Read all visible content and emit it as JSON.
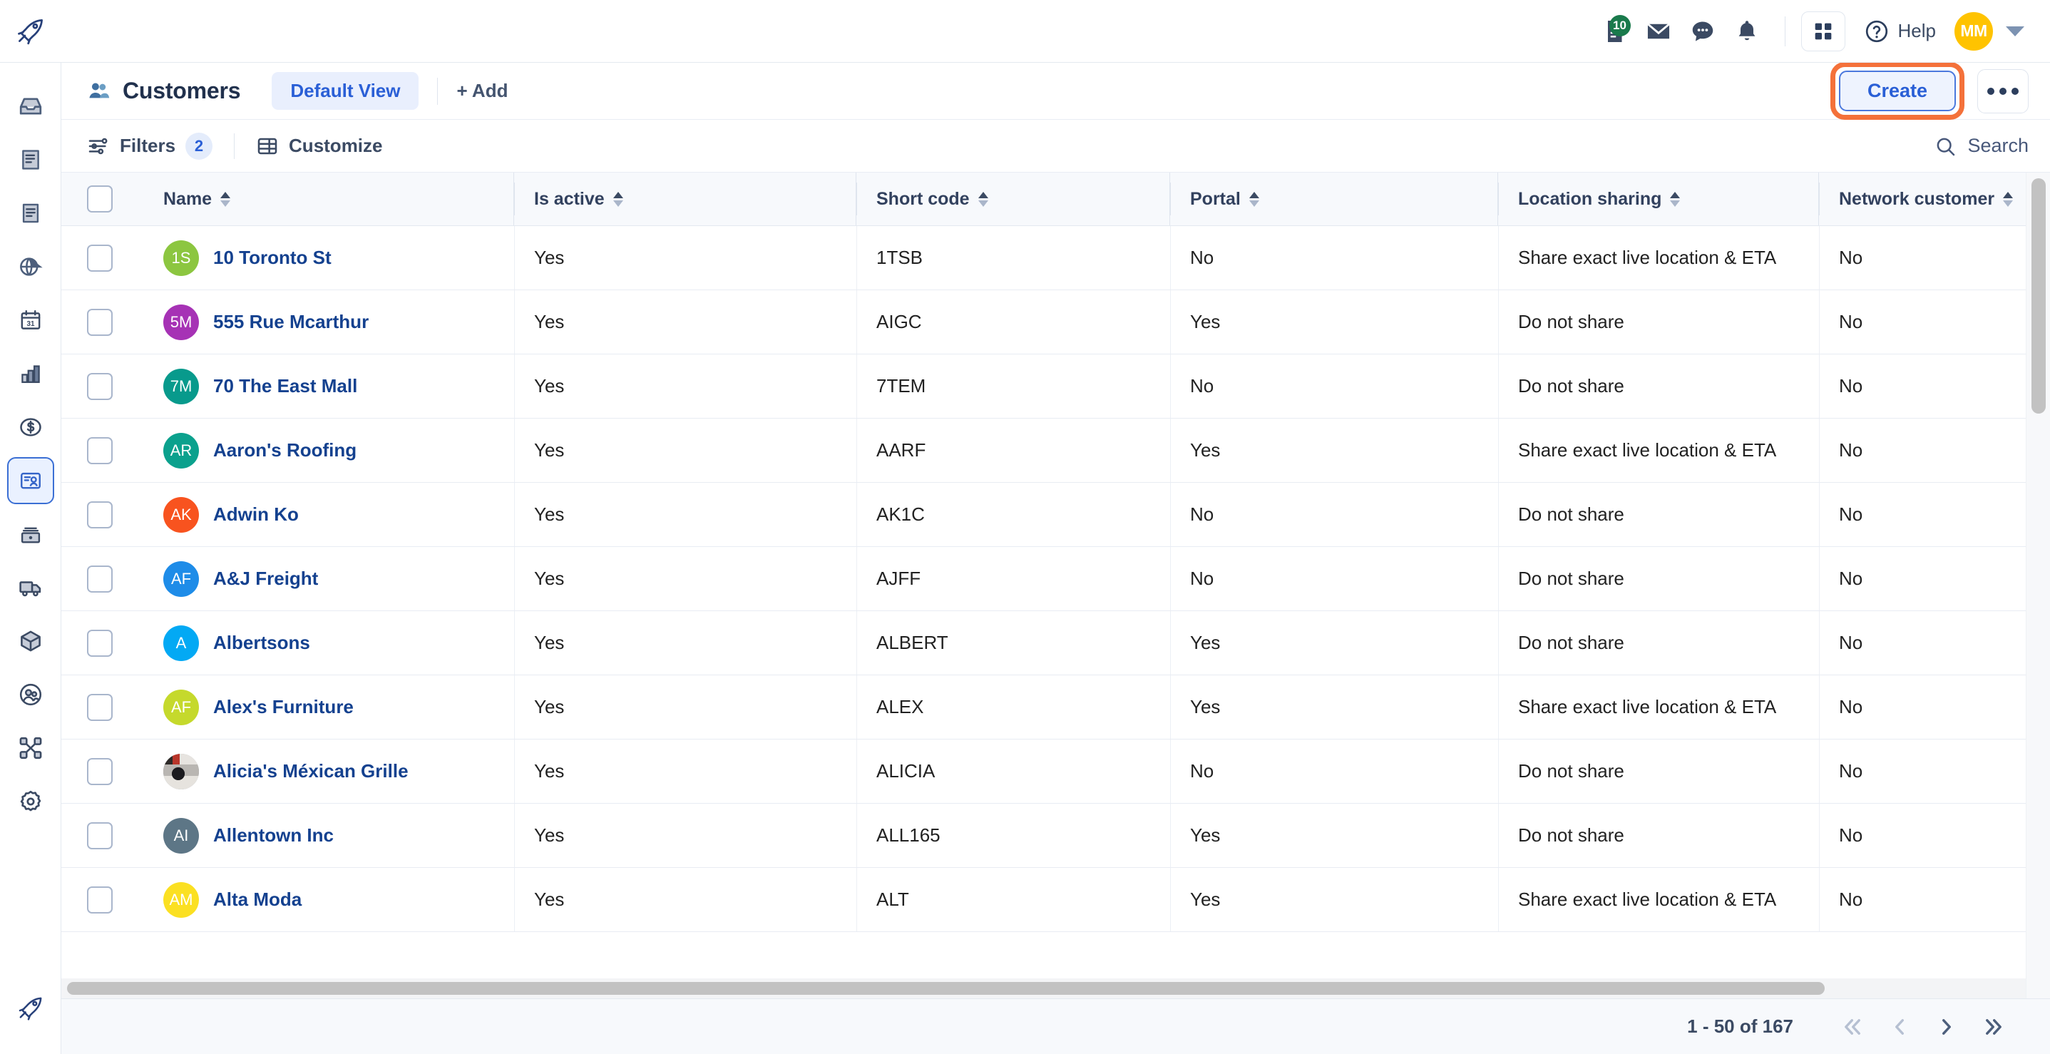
{
  "topbar": {
    "logo_icon": "rocket-icon",
    "icons": [
      {
        "name": "document-notes-icon",
        "badge": "10"
      },
      {
        "name": "mail-envelope-icon",
        "badge": ""
      },
      {
        "name": "chat-bubble-icon",
        "badge": ""
      },
      {
        "name": "bell-notification-icon",
        "badge": ""
      }
    ],
    "apps_icon": "apps-grid-icon",
    "help_icon": "question-circle-icon",
    "help_label": "Help",
    "user_initials": "MM",
    "user_avatar_color": "#ffc300",
    "user_caret_icon": "chevron-down-icon"
  },
  "sidebar": {
    "items": [
      {
        "name": "inbox-icon",
        "active": false
      },
      {
        "name": "document-lines-icon",
        "active": false
      },
      {
        "name": "document-text-icon",
        "active": false
      },
      {
        "name": "globe-pie-icon",
        "active": false
      },
      {
        "name": "calendar-31-icon",
        "active": false
      },
      {
        "name": "bar-chart-icon",
        "active": false
      },
      {
        "name": "dollar-circle-icon",
        "active": false
      },
      {
        "name": "customers-card-icon",
        "active": true
      },
      {
        "name": "inventory-stack-icon",
        "active": false
      },
      {
        "name": "truck-delivery-icon",
        "active": false
      },
      {
        "name": "cube-package-icon",
        "active": false
      },
      {
        "name": "team-people-icon",
        "active": false
      },
      {
        "name": "network-nodes-icon",
        "active": false
      },
      {
        "name": "settings-gear-icon",
        "active": false
      }
    ],
    "bottom_item": {
      "name": "rocket-launch-icon"
    }
  },
  "pagehead": {
    "title_icon": "people-icon",
    "title": "Customers",
    "view_tab": "Default View",
    "add_view": "+ Add",
    "create_label": "Create",
    "more_icon": "ellipsis-icon",
    "highlight_color": "#f4713a"
  },
  "toolbar": {
    "filters_icon": "filter-sliders-icon",
    "filters_label": "Filters",
    "filters_count": "2",
    "customize_icon": "table-layout-icon",
    "customize_label": "Customize",
    "search_icon": "search-icon",
    "search_label": "Search"
  },
  "table": {
    "columns": [
      {
        "key": "name",
        "label": "Name",
        "sortable": true
      },
      {
        "key": "is_active",
        "label": "Is active",
        "sortable": true
      },
      {
        "key": "short_code",
        "label": "Short code",
        "sortable": true
      },
      {
        "key": "portal",
        "label": "Portal",
        "sortable": true
      },
      {
        "key": "location_sharing",
        "label": "Location sharing",
        "sortable": true
      },
      {
        "key": "network_customer",
        "label": "Network customer",
        "sortable": true
      }
    ],
    "rows": [
      {
        "initials": "1S",
        "color": "#8cc640",
        "photo": false,
        "name": "10 Toronto St",
        "is_active": "Yes",
        "short_code": "1TSB",
        "portal": "No",
        "location_sharing": "Share exact live location & ETA",
        "network_customer": "No"
      },
      {
        "initials": "5M",
        "color": "#a632b5",
        "photo": false,
        "name": "555 Rue Mcarthur",
        "is_active": "Yes",
        "short_code": "AIGC",
        "portal": "Yes",
        "location_sharing": "Do not share",
        "network_customer": "No"
      },
      {
        "initials": "7M",
        "color": "#089a8c",
        "photo": false,
        "name": "70 The East Mall",
        "is_active": "Yes",
        "short_code": "7TEM",
        "portal": "No",
        "location_sharing": "Do not share",
        "network_customer": "No"
      },
      {
        "initials": "AR",
        "color": "#0ba18d",
        "photo": false,
        "name": "Aaron's Roofing",
        "is_active": "Yes",
        "short_code": "AARF",
        "portal": "Yes",
        "location_sharing": "Share exact live location & ETA",
        "network_customer": "No"
      },
      {
        "initials": "AK",
        "color": "#f8531f",
        "photo": false,
        "name": "Adwin Ko",
        "is_active": "Yes",
        "short_code": "AK1C",
        "portal": "No",
        "location_sharing": "Do not share",
        "network_customer": "No"
      },
      {
        "initials": "AF",
        "color": "#1e8ce8",
        "photo": false,
        "name": "A&J Freight",
        "is_active": "Yes",
        "short_code": "AJFF",
        "portal": "No",
        "location_sharing": "Do not share",
        "network_customer": "No"
      },
      {
        "initials": "A",
        "color": "#03a9f4",
        "photo": false,
        "name": "Albertsons",
        "is_active": "Yes",
        "short_code": "ALBERT",
        "portal": "Yes",
        "location_sharing": "Do not share",
        "network_customer": "No"
      },
      {
        "initials": "AF",
        "color": "#c5d92c",
        "photo": false,
        "name": "Alex's Furniture",
        "is_active": "Yes",
        "short_code": "ALEX",
        "portal": "Yes",
        "location_sharing": "Share exact live location & ETA",
        "network_customer": "No"
      },
      {
        "initials": "",
        "color": "#8a8f96",
        "photo": true,
        "name": "Alicia's Méxican Grille",
        "is_active": "Yes",
        "short_code": "ALICIA",
        "portal": "No",
        "location_sharing": "Do not share",
        "network_customer": "No"
      },
      {
        "initials": "AI",
        "color": "#5d7686",
        "photo": false,
        "name": "Allentown Inc",
        "is_active": "Yes",
        "short_code": "ALL165",
        "portal": "Yes",
        "location_sharing": "Do not share",
        "network_customer": "No"
      },
      {
        "initials": "AM",
        "color": "#fbe022",
        "photo": false,
        "name": "Alta Moda",
        "is_active": "Yes",
        "short_code": "ALT",
        "portal": "Yes",
        "location_sharing": "Share exact live location & ETA",
        "network_customer": "No"
      }
    ]
  },
  "footer": {
    "page_info": "1 - 50 of 167",
    "first_icon": "double-chevron-left-icon",
    "prev_icon": "chevron-left-icon",
    "next_icon": "chevron-right-icon",
    "last_icon": "double-chevron-right-icon"
  }
}
